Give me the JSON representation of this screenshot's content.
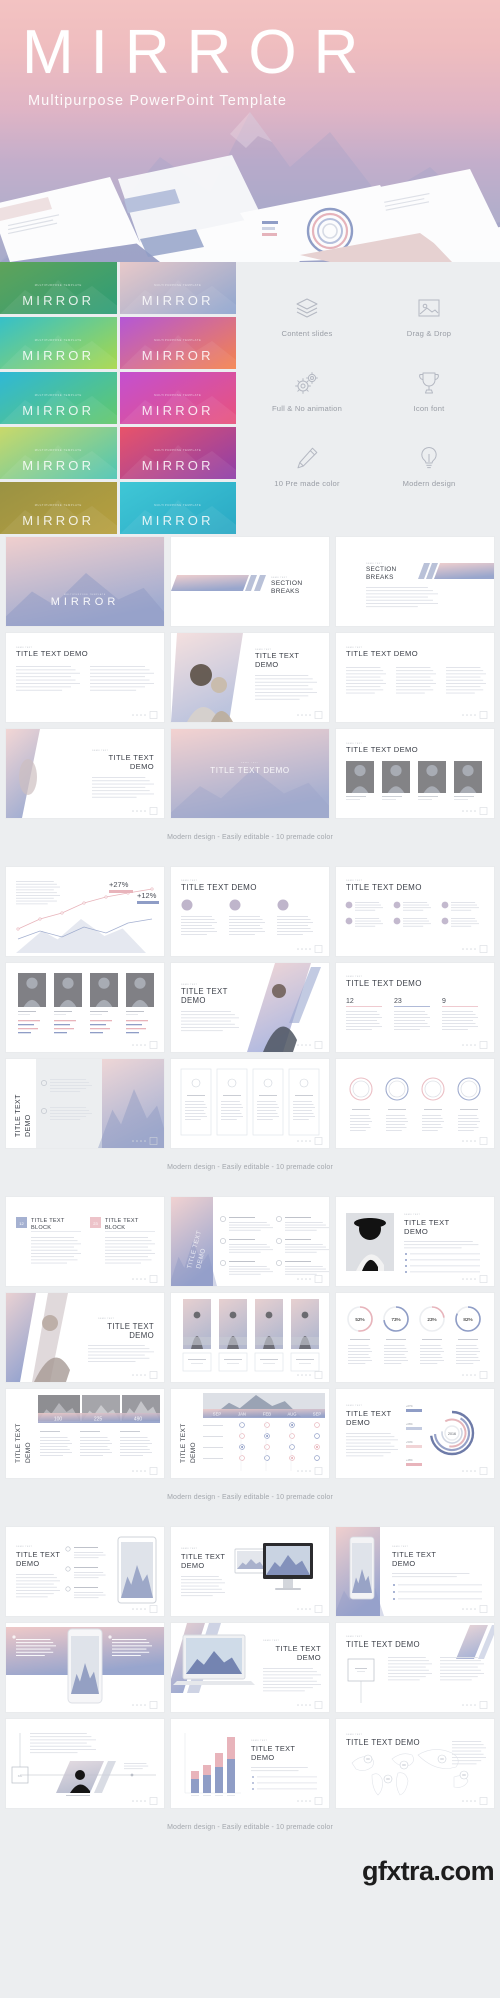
{
  "hero": {
    "title": "MIRROR",
    "subtitle": "Multipurpose PowerPoint Template"
  },
  "swatches": {
    "label": "MIRROR",
    "tiny_label": "MULTIPURPOSE TEMPLATE",
    "items": [
      {
        "name": "green",
        "from": "#5fa35a",
        "to": "#2e9d77"
      },
      {
        "name": "pink-blue",
        "from": "#e8c9c9",
        "to": "#8fa6cf"
      },
      {
        "name": "teal-lime",
        "from": "#35c0c9",
        "to": "#a8d84a"
      },
      {
        "name": "purple-orange",
        "from": "#b457d6",
        "to": "#f4834e"
      },
      {
        "name": "cyan-green",
        "from": "#2fb8d6",
        "to": "#63c86a"
      },
      {
        "name": "magenta-pink",
        "from": "#c44fd0",
        "to": "#e8537c"
      },
      {
        "name": "lime-teal",
        "from": "#c9d96a",
        "to": "#4ec5b4"
      },
      {
        "name": "crimson-purple",
        "from": "#e8536a",
        "to": "#8e3fa8"
      },
      {
        "name": "olive-gold",
        "from": "#9a9243",
        "to": "#b7a03f"
      },
      {
        "name": "aqua-blue",
        "from": "#3fc7d6",
        "to": "#2aa8c4"
      }
    ]
  },
  "features": [
    {
      "icon": "layers-icon",
      "label": "Content slides"
    },
    {
      "icon": "image-icon",
      "label": "Drag & Drop"
    },
    {
      "icon": "gears-icon",
      "label": "Full & No animation"
    },
    {
      "icon": "trophy-icon",
      "label": "Icon font"
    },
    {
      "icon": "pencil-icon",
      "label": "10 Pre made color"
    },
    {
      "icon": "lightbulb-icon",
      "label": "Modern design"
    }
  ],
  "sections": [
    {
      "name": "section-1",
      "caption": "Modern design - Easily editable - 10 premade color",
      "slides": [
        {
          "type": "cover",
          "title": "MIRROR"
        },
        {
          "type": "section-break",
          "title": "SECTION BREAKS",
          "eyebrow": "DEMO TEXT"
        },
        {
          "type": "section-break-right",
          "title": "SECTION BREAKS",
          "eyebrow": "DEMO TEXT"
        },
        {
          "type": "text-left",
          "title": "TITLE TEXT DEMO",
          "eyebrow": "DEMO TEXT"
        },
        {
          "type": "photo-text",
          "title": "TITLE TEXT DEMO",
          "eyebrow": "DEMO TEXT"
        },
        {
          "type": "text-cols",
          "title": "TITLE TEXT DEMO",
          "eyebrow": "DEMO TEXT"
        },
        {
          "type": "angle-photo",
          "title": "TITLE TEXT DEMO",
          "eyebrow": "DEMO TEXT"
        },
        {
          "type": "gradient-title",
          "title": "TITLE TEXT DEMO"
        },
        {
          "type": "team-grid",
          "title": "TITLE TEXT DEMO",
          "eyebrow": "DEMO TEXT"
        }
      ]
    },
    {
      "name": "section-2",
      "caption": "Modern design - Easily editable - 10 premade color",
      "slides": [
        {
          "type": "line-chart",
          "title": "",
          "badges": [
            "+27%",
            "+12%"
          ]
        },
        {
          "type": "three-circles",
          "title": "TITLE TEXT DEMO",
          "eyebrow": "DEMO TEXT"
        },
        {
          "type": "six-bullets",
          "title": "TITLE TEXT DEMO",
          "eyebrow": "DEMO TEXT"
        },
        {
          "type": "team-4",
          "title": "",
          "eyebrow": ""
        },
        {
          "type": "angle-person",
          "title": "TITLE TEXT DEMO",
          "eyebrow": "DEMO TEXT"
        },
        {
          "type": "stats",
          "title": "TITLE TEXT DEMO",
          "eyebrow": "DEMO TEXT",
          "values": [
            "12",
            "23",
            "9"
          ]
        },
        {
          "type": "side-title-photo",
          "title": "TITLE TEXT DEMO"
        },
        {
          "type": "four-cards",
          "title": "",
          "eyebrow": ""
        },
        {
          "type": "four-rings",
          "title": "",
          "eyebrow": ""
        }
      ]
    },
    {
      "name": "section-3",
      "caption": "Modern design - Easily editable - 10 premade color",
      "slides": [
        {
          "type": "two-blocks",
          "titles": [
            "TITLE TEXT BLOCK",
            "TITLE TEXT BLOCK"
          ],
          "numbers": [
            "12",
            "23"
          ]
        },
        {
          "type": "vertical-title-bullets",
          "title": "TITLE TEXT DEMO"
        },
        {
          "type": "photo-right",
          "title": "TITLE TEXT DEMO",
          "eyebrow": "DEMO TEXT"
        },
        {
          "type": "angle-photo-2",
          "title": "TITLE TEXT DEMO",
          "eyebrow": "DEMO TEXT"
        },
        {
          "type": "four-models",
          "title": "",
          "eyebrow": ""
        },
        {
          "type": "percent-rings",
          "values": [
            "52%",
            "73%",
            "23%",
            "82%"
          ]
        },
        {
          "type": "photo-table",
          "title": "TITLE TEXT DEMO",
          "headers": [
            "100",
            "225",
            "490"
          ]
        },
        {
          "type": "month-table",
          "title": "TITLE TEXT DEMO",
          "headers": [
            "SEP",
            "JAN",
            "FEB",
            "AUG",
            "SEP"
          ]
        },
        {
          "type": "radial-chart",
          "title": "TITLE TEXT DEMO",
          "eyebrow": "DEMO TEXT",
          "center": "2016",
          "legend": [
            "+67%",
            "+68%",
            "+50%",
            "+48%"
          ]
        }
      ]
    },
    {
      "name": "section-4",
      "caption": "Modern design - Easily editable - 10 premade color",
      "slides": [
        {
          "type": "tablet-mock",
          "title": "TITLE TEXT DEMO",
          "eyebrow": "DEMO TEXT"
        },
        {
          "type": "desktop-mock",
          "title": "TITLE TEXT DEMO",
          "eyebrow": "DEMO TEXT"
        },
        {
          "type": "phone-mock",
          "title": "TITLE TEXT DEMO",
          "eyebrow": "DEMO TEXT"
        },
        {
          "type": "phone-split",
          "title": "",
          "eyebrow": ""
        },
        {
          "type": "laptop-mock",
          "title": "TITLE TEXT DEMO",
          "eyebrow": "DEMO TEXT"
        },
        {
          "type": "timeline-box",
          "title": "TITLE TEXT DEMO",
          "eyebrow": "DEMO TEXT"
        },
        {
          "type": "timeline-flow",
          "title": "",
          "eyebrow": ""
        },
        {
          "type": "bar-chart",
          "title": "TITLE TEXT DEMO",
          "eyebrow": "DEMO TEXT"
        },
        {
          "type": "world-map",
          "title": "TITLE TEXT DEMO",
          "eyebrow": "DEMO TEXT"
        }
      ]
    }
  ],
  "watermark": "gfxtra.com",
  "colors": {
    "bg": "#eceef0",
    "slide_bg": "#ffffff",
    "accent_pink": "#e8b4bb",
    "accent_blue": "#8f9dc6",
    "text_dark": "#3c4049",
    "text_muted": "#a3a7ad"
  }
}
